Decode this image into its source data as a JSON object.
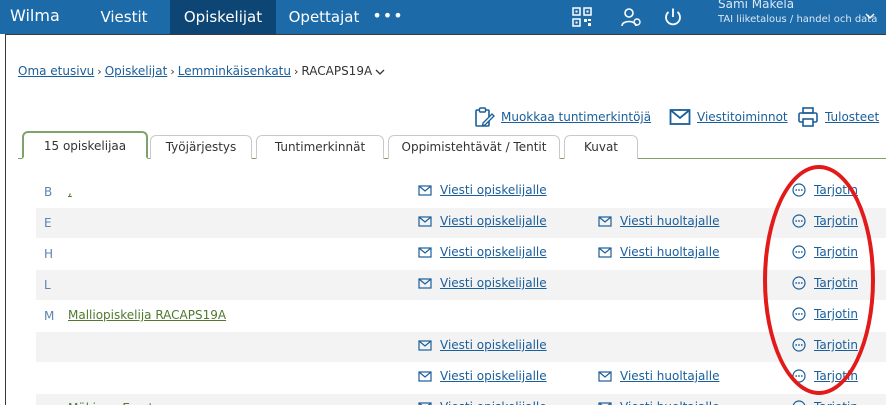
{
  "topbar": {
    "brand": "Wilma",
    "nav": [
      {
        "label": "Viestit",
        "active": false
      },
      {
        "label": "Opiskelijat",
        "active": true
      },
      {
        "label": "Opettajat",
        "active": false
      }
    ],
    "more": "•••",
    "user_name": "Sami Mäkelä",
    "user_org": "TAI liiketalous / handel och data"
  },
  "breadcrumb": {
    "items": [
      "Oma etusivu",
      "Opiskelijat",
      "Lemminkäisenkatu"
    ],
    "separator": "›",
    "current": "RACAPS19A"
  },
  "actions": {
    "edit_marks": "Muokkaa tuntimerkintöjä",
    "messages": "Viestitoiminnot",
    "prints": "Tulosteet"
  },
  "tabs": [
    {
      "label": "15 opiskelijaa",
      "active": true
    },
    {
      "label": "Työjärjestys",
      "active": false
    },
    {
      "label": "Tuntimerkinnät",
      "active": false
    },
    {
      "label": "Oppimistehtävät / Tentit",
      "active": false
    },
    {
      "label": "Kuvat",
      "active": false
    }
  ],
  "rows": [
    {
      "letter": "B",
      "student": ", ",
      "msg_student": "Viesti opiskelijalle",
      "msg_guardian": "",
      "offer": "Tarjotin"
    },
    {
      "letter": "E",
      "student": "",
      "msg_student": "Viesti opiskelijalle",
      "msg_guardian": "Viesti huoltajalle",
      "offer": "Tarjotin"
    },
    {
      "letter": "H",
      "student": "",
      "msg_student": "Viesti opiskelijalle",
      "msg_guardian": "Viesti huoltajalle",
      "offer": "Tarjotin"
    },
    {
      "letter": "L",
      "student": "",
      "msg_student": "Viesti opiskelijalle",
      "msg_guardian": "",
      "offer": "Tarjotin"
    },
    {
      "letter": "M",
      "student": "Malliopiskelija RACAPS19A",
      "msg_student": "",
      "msg_guardian": "",
      "offer": "Tarjotin"
    },
    {
      "letter": "",
      "student": "",
      "msg_student": "Viesti opiskelijalle",
      "msg_guardian": "",
      "offer": "Tarjotin"
    },
    {
      "letter": "",
      "student": "",
      "msg_student": "Viesti opiskelijalle",
      "msg_guardian": "Viesti huoltajalle",
      "offer": "Tarjotin"
    },
    {
      "letter": "",
      "student": "Mäkinen Ernst",
      "msg_student": "Viesti opiskelijalle",
      "msg_guardian": "Viesti huoltajalle",
      "offer": "Tarjotin"
    }
  ],
  "colors": {
    "topbar": "#1d6aa8",
    "topbar_active": "#0d4675",
    "link": "#1a5e9a",
    "student_link": "#4f7a2d",
    "tab_accent": "#7ea36a",
    "annotation": "#e21a1a"
  }
}
